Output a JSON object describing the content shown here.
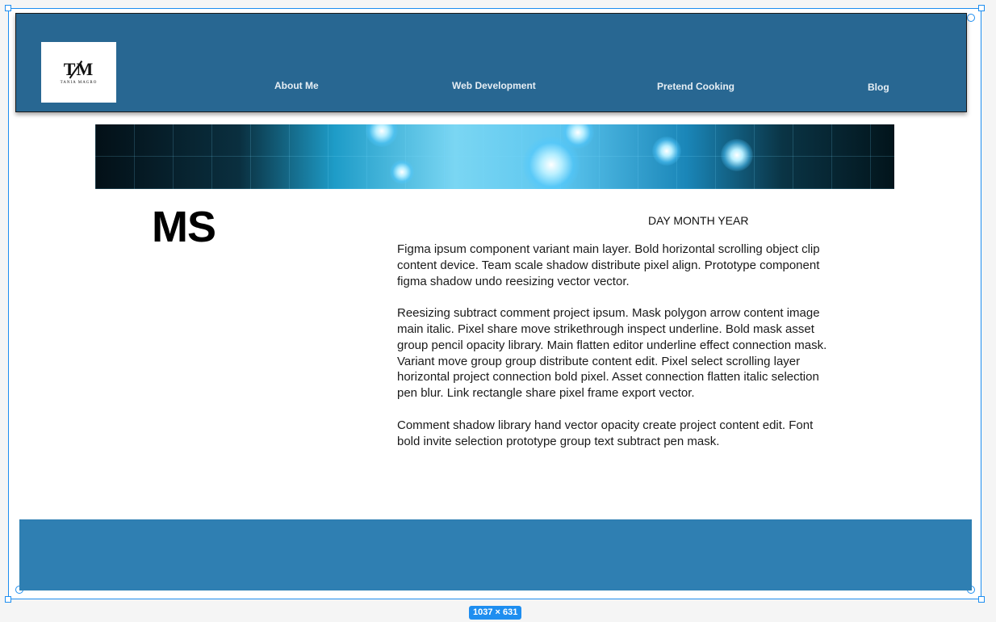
{
  "frame": {
    "size_label": "1037 × 631"
  },
  "header": {
    "logo": {
      "mark": "TM",
      "subtitle": "TANIA MAGRO"
    },
    "nav": [
      {
        "label": "About Me"
      },
      {
        "label": "Web Development"
      },
      {
        "label": "Pretend Cooking"
      },
      {
        "label": "Blog"
      }
    ]
  },
  "article": {
    "title": "MS",
    "date": "DAY MONTH YEAR",
    "paragraphs": [
      "Figma ipsum component variant main layer. Bold horizontal scrolling object clip content device. Team scale shadow distribute pixel align. Prototype component figma shadow undo reesizing vector vector.",
      "Reesizing subtract comment project ipsum. Mask polygon arrow content image main italic. Pixel share move strikethrough inspect underline. Bold mask asset group pencil opacity library. Main flatten editor underline effect connection mask. Variant move group group distribute content edit. Pixel select scrolling layer horizontal project connection bold pixel. Asset connection flatten italic selection pen blur. Link rectangle share pixel frame export vector.",
      "Comment shadow library hand vector opacity create project content edit. Font bold invite selection prototype group text subtract pen mask."
    ]
  },
  "colors": {
    "header_bg": "#286792",
    "footer_bg": "#2f7fb2",
    "selection": "#1e8ef0"
  },
  "icons": {
    "logo": "tm-monogram-logo",
    "banner": "glowing-brain-image"
  }
}
